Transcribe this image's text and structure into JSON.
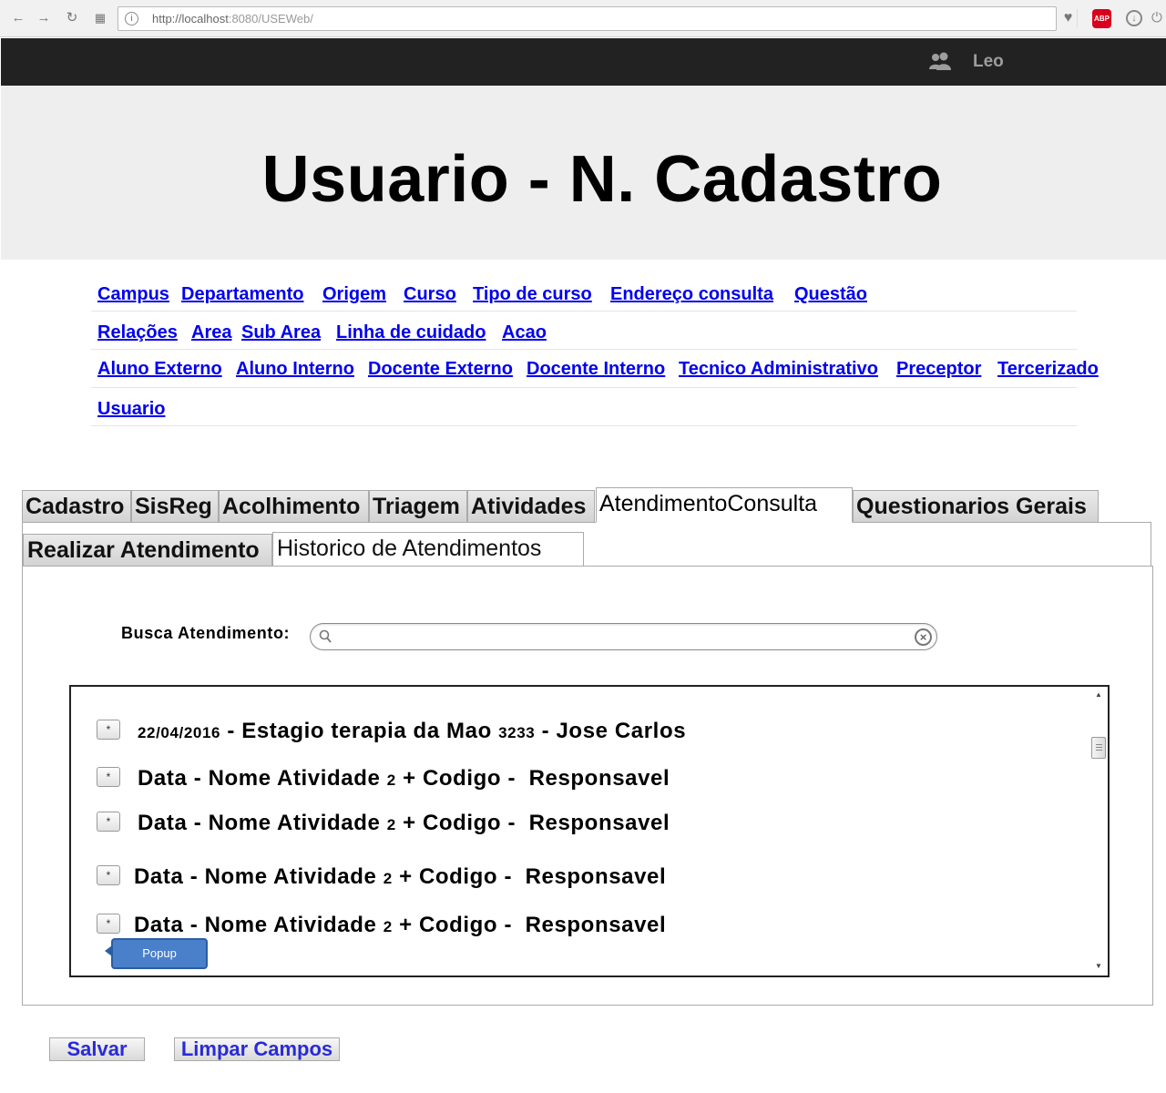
{
  "browser": {
    "url": "http://localhost:8080/USEWeb/",
    "url_host": "http://localhost",
    "url_rest": ":8080/USEWeb/",
    "abp_label": "ABP"
  },
  "topbar": {
    "user_name": "Leo"
  },
  "header": {
    "title": "Usuario - N. Cadastro"
  },
  "menu": {
    "row1": [
      "Campus",
      "Departamento",
      "Origem",
      "Curso",
      "Tipo de curso",
      "Endereço consulta",
      "Questão"
    ],
    "row2": [
      "Relações",
      "Area",
      "Sub Area",
      "Linha de cuidado",
      "Acao"
    ],
    "row3": [
      "Aluno Externo",
      "Aluno Interno",
      "Docente Externo",
      "Docente Interno",
      "Tecnico Administrativo",
      "Preceptor",
      "Tercerizado"
    ],
    "row4": [
      "Usuario"
    ]
  },
  "tabs": [
    "Cadastro",
    "SisReg",
    "Acolhimento",
    "Triagem",
    "Atividades",
    "AtendimentoConsulta",
    "Questionarios Gerais"
  ],
  "active_tab": "AtendimentoConsulta",
  "subtabs": [
    "Realizar Atendimento",
    "Historico de Atendimentos"
  ],
  "active_subtab": "Historico de Atendimentos",
  "search": {
    "label": "Busca Atendimento:",
    "value": "",
    "placeholder": ""
  },
  "list": {
    "button_label": "*",
    "items": [
      {
        "date": "22/04/2016",
        "sep1": " - ",
        "name": "Estagio terapia da Mao",
        "code": "3233",
        "sep2": " - ",
        "responsible": "Jose Carlos"
      },
      {
        "date": "Data",
        "sep1": " - ",
        "name": "Nome Atividade",
        "code": "2",
        "sep2": " + Codigo -  ",
        "responsible": "Responsavel"
      },
      {
        "date": "Data",
        "sep1": " - ",
        "name": "Nome Atividade",
        "code": "2",
        "sep2": " + Codigo -  ",
        "responsible": "Responsavel"
      },
      {
        "date": "Data",
        "sep1": " - ",
        "name": "Nome Atividade",
        "code": "2",
        "sep2": " + Codigo -  ",
        "responsible": "Responsavel"
      },
      {
        "date": "Data",
        "sep1": " - ",
        "name": "Nome Atividade",
        "code": "2",
        "sep2": " + Codigo -  ",
        "responsible": "Responsavel"
      }
    ],
    "popup_label": "Popup"
  },
  "actions": {
    "save_label": "Salvar",
    "clear_label": "Limpar Campos"
  },
  "colors": {
    "topbar_bg": "#222222",
    "header_bg": "#eeeeee",
    "link": "#0000ee",
    "button_text": "#2a2ad8",
    "popup_bg": "#4a7fc9"
  }
}
